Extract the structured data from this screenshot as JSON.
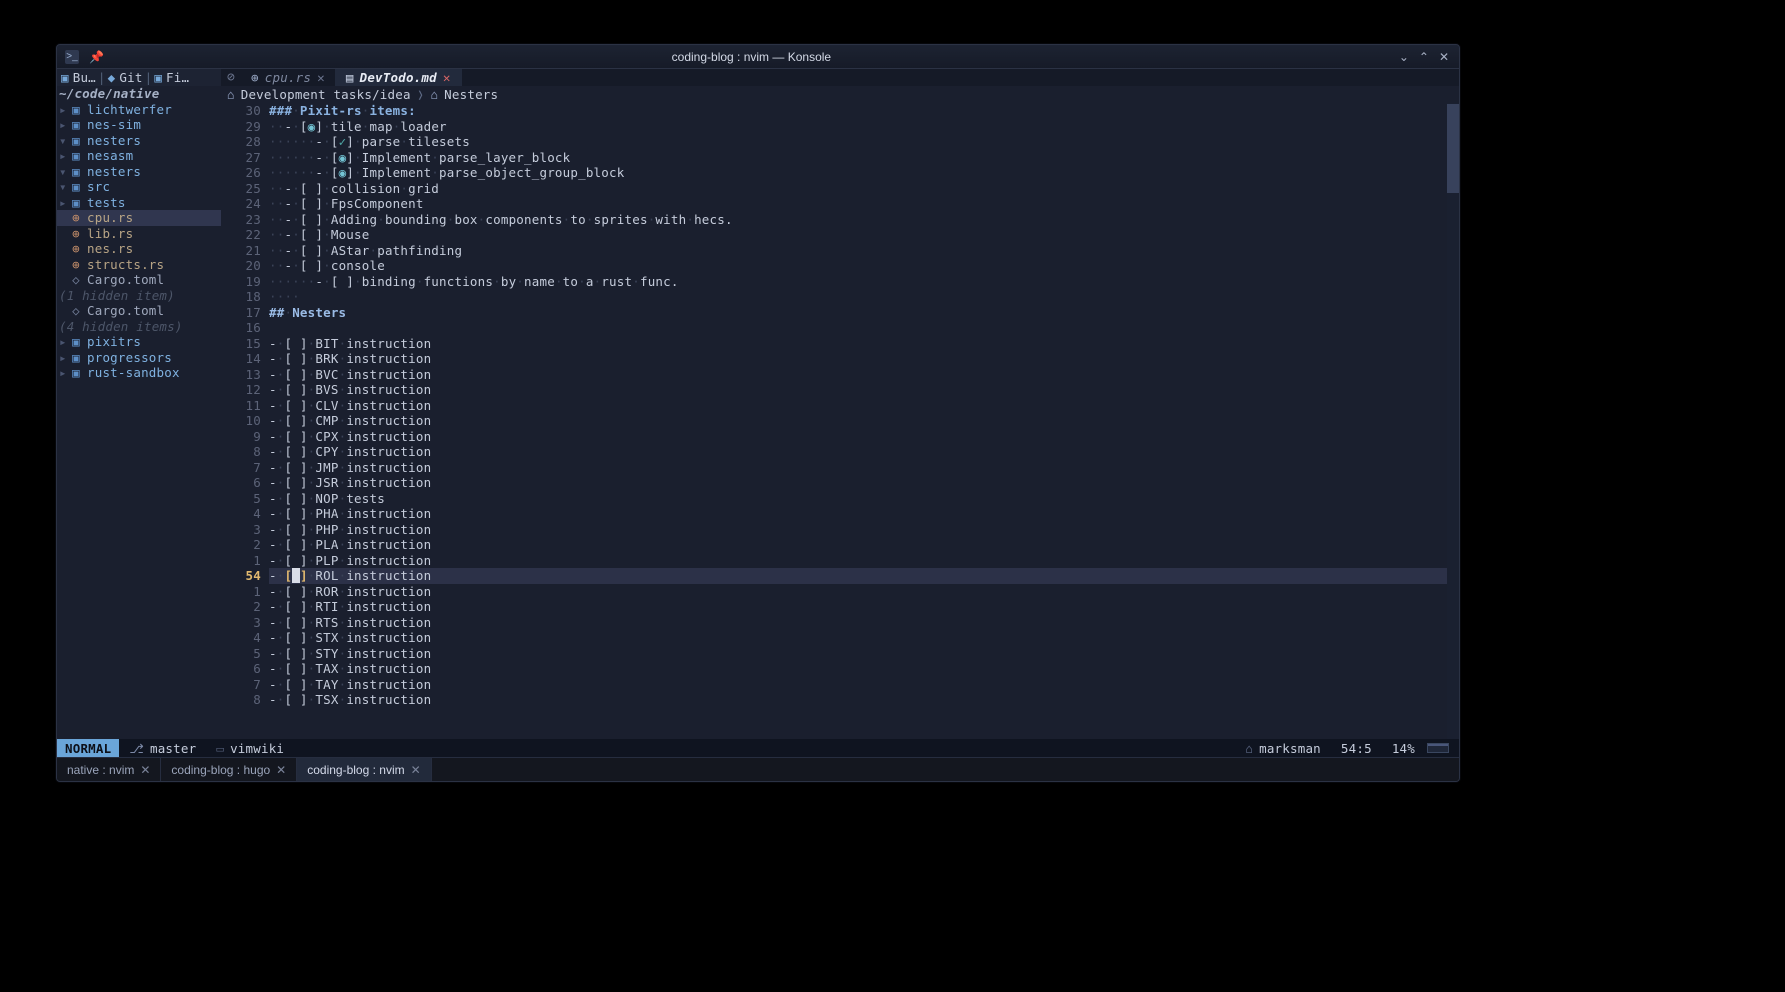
{
  "window": {
    "title": "coding-blog : nvim — Konsole"
  },
  "konsole_tabs": [
    {
      "label": "native : nvim",
      "active": false
    },
    {
      "label": "coding-blog : hugo",
      "active": false
    },
    {
      "label": "coding-blog : nvim",
      "active": true
    }
  ],
  "tree": {
    "crumbs": [
      {
        "icon": "folder",
        "label": "Bu…"
      },
      {
        "icon": "git",
        "label": "Git"
      },
      {
        "icon": "folder",
        "label": "Fi…"
      }
    ],
    "root": "~/code/native",
    "items": [
      {
        "depth": 1,
        "kind": "folder",
        "label": "lichtwerfer"
      },
      {
        "depth": 1,
        "kind": "folder",
        "label": "nes-sim"
      },
      {
        "depth": 1,
        "kind": "folder-open",
        "label": "nesters"
      },
      {
        "depth": 2,
        "kind": "folder",
        "label": "nesasm"
      },
      {
        "depth": 2,
        "kind": "folder-open",
        "label": "nesters"
      },
      {
        "depth": 3,
        "kind": "folder-open",
        "label": "src"
      },
      {
        "depth": 4,
        "kind": "folder",
        "label": "tests"
      },
      {
        "depth": 4,
        "kind": "file",
        "label": "cpu.rs",
        "selected": true
      },
      {
        "depth": 4,
        "kind": "file",
        "label": "lib.rs"
      },
      {
        "depth": 4,
        "kind": "file",
        "label": "nes.rs"
      },
      {
        "depth": 4,
        "kind": "file",
        "label": "structs.rs"
      },
      {
        "depth": 3,
        "kind": "toml",
        "label": "Cargo.toml"
      },
      {
        "depth": 3,
        "kind": "note",
        "label": "(1 hidden item)"
      },
      {
        "depth": 2,
        "kind": "toml",
        "label": "Cargo.toml"
      },
      {
        "depth": 2,
        "kind": "note",
        "label": "(4 hidden items)"
      },
      {
        "depth": 1,
        "kind": "folder",
        "label": "pixitrs"
      },
      {
        "depth": 1,
        "kind": "folder",
        "label": "progressors"
      },
      {
        "depth": 1,
        "kind": "folder",
        "label": "rust-sandbox"
      }
    ]
  },
  "editor": {
    "tabs": [
      {
        "icon": "rust",
        "label": "cpu.rs",
        "active": false
      },
      {
        "icon": "md",
        "label": "DevTodo.md",
        "active": true,
        "modified": true
      }
    ],
    "winbar": [
      {
        "label": "Development tasks/idea"
      },
      {
        "label": "Nesters"
      }
    ],
    "cursor": {
      "line": 54,
      "col": 5
    },
    "lines": [
      {
        "rel": 30,
        "raw": "### Pixit-rs items:",
        "style": "h3"
      },
      {
        "rel": 29,
        "raw": "  - [o] tile map loader",
        "dots": "··",
        "chk": "o"
      },
      {
        "rel": 28,
        "raw": "      - [✓] parse tilesets",
        "dots": "······",
        "chk": "v"
      },
      {
        "rel": 27,
        "raw": "      - [o] Implement parse_layer_block",
        "dots": "······",
        "chk": "o"
      },
      {
        "rel": 26,
        "raw": "      - [o] Implement parse_object_group_block",
        "dots": "······",
        "chk": "o"
      },
      {
        "rel": 25,
        "raw": "  - [ ] collision grid",
        "dots": "··"
      },
      {
        "rel": 24,
        "raw": "  - [ ] FpsComponent",
        "dots": "··"
      },
      {
        "rel": 23,
        "raw": "  - [ ] Adding bounding box components to sprites with hecs.",
        "dots": "··"
      },
      {
        "rel": 22,
        "raw": "  - [ ] Mouse",
        "dots": "··"
      },
      {
        "rel": 21,
        "raw": "  - [ ] AStar pathfinding",
        "dots": "··"
      },
      {
        "rel": 20,
        "raw": "  - [ ] console",
        "dots": "··"
      },
      {
        "rel": 19,
        "raw": "      - [ ] binding functions by name to a rust func.",
        "dots": "······"
      },
      {
        "rel": 18,
        "raw": "",
        "dots": "····"
      },
      {
        "rel": 17,
        "raw": "## Nesters",
        "style": "h2"
      },
      {
        "rel": 16,
        "raw": ""
      },
      {
        "rel": 15,
        "raw": "- [ ] BIT instruction"
      },
      {
        "rel": 14,
        "raw": "- [ ] BRK instruction"
      },
      {
        "rel": 13,
        "raw": "- [ ] BVC instruction"
      },
      {
        "rel": 12,
        "raw": "- [ ] BVS instruction"
      },
      {
        "rel": 11,
        "raw": "- [ ] CLV instruction"
      },
      {
        "rel": 10,
        "raw": "- [ ] CMP instruction"
      },
      {
        "rel": 9,
        "raw": "- [ ] CPX instruction"
      },
      {
        "rel": 8,
        "raw": "- [ ] CPY instruction"
      },
      {
        "rel": 7,
        "raw": "- [ ] JMP instruction"
      },
      {
        "rel": 6,
        "raw": "- [ ] JSR instruction"
      },
      {
        "rel": 5,
        "raw": "- [ ] NOP tests"
      },
      {
        "rel": 4,
        "raw": "- [ ] PHA instruction"
      },
      {
        "rel": 3,
        "raw": "- [ ] PHP instruction"
      },
      {
        "rel": 2,
        "raw": "- [ ] PLA instruction"
      },
      {
        "rel": 1,
        "raw": "- [ ] PLP instruction"
      },
      {
        "rel": 54,
        "raw": "- [ ] ROL instruction",
        "current": true
      },
      {
        "rel": 1,
        "raw": "- [ ] ROR instruction"
      },
      {
        "rel": 2,
        "raw": "- [ ] RTI instruction"
      },
      {
        "rel": 3,
        "raw": "- [ ] RTS instruction"
      },
      {
        "rel": 4,
        "raw": "- [ ] STX instruction"
      },
      {
        "rel": 5,
        "raw": "- [ ] STY instruction"
      },
      {
        "rel": 6,
        "raw": "- [ ] TAX instruction"
      },
      {
        "rel": 7,
        "raw": "- [ ] TAY instruction"
      },
      {
        "rel": 8,
        "raw": "- [ ] TSX instruction"
      }
    ]
  },
  "statusline": {
    "mode": "NORMAL",
    "branch": "master",
    "filetype": "vimwiki",
    "lsp": "marksman",
    "pos": "54:5",
    "percent": "14%"
  }
}
